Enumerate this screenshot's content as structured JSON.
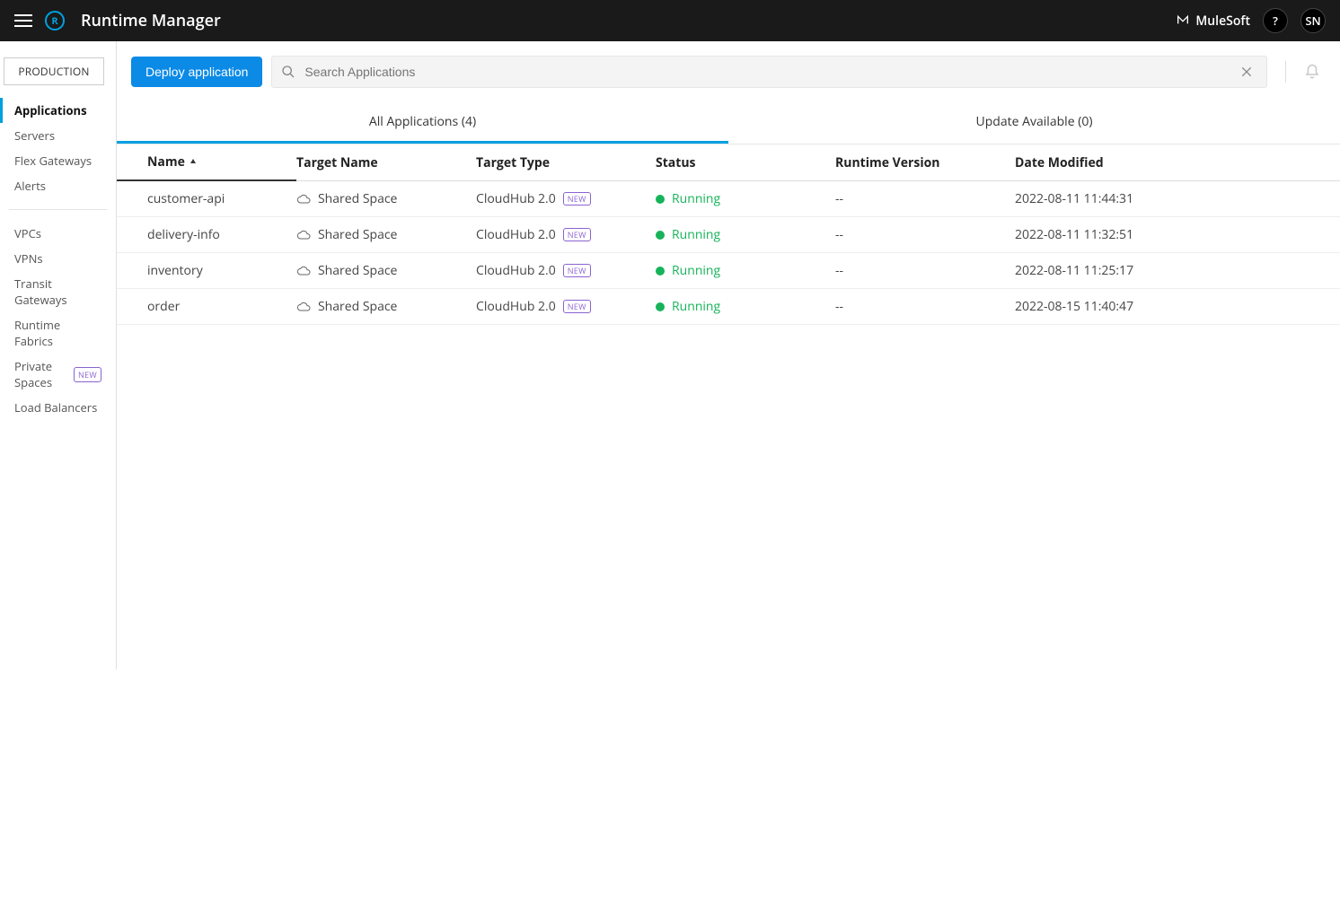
{
  "header": {
    "title": "Runtime Manager",
    "brand": "MuleSoft",
    "help_label": "?",
    "user_initials": "SN"
  },
  "sidebar": {
    "environment": "PRODUCTION",
    "primary": [
      {
        "label": "Applications",
        "active": true
      },
      {
        "label": "Servers",
        "active": false
      },
      {
        "label": "Flex Gateways",
        "active": false
      },
      {
        "label": "Alerts",
        "active": false
      }
    ],
    "secondary": [
      {
        "label": "VPCs",
        "badge": null
      },
      {
        "label": "VPNs",
        "badge": null
      },
      {
        "label": "Transit Gateways",
        "badge": null
      },
      {
        "label": "Runtime Fabrics",
        "badge": null
      },
      {
        "label": "Private Spaces",
        "badge": "NEW"
      },
      {
        "label": "Load Balancers",
        "badge": null
      }
    ]
  },
  "toolbar": {
    "deploy_label": "Deploy application",
    "search_placeholder": "Search Applications"
  },
  "tabs": [
    {
      "label": "All Applications (4)",
      "active": true
    },
    {
      "label": "Update Available (0)",
      "active": false
    }
  ],
  "table": {
    "headers": {
      "name": "Name",
      "target_name": "Target Name",
      "target_type": "Target Type",
      "status": "Status",
      "runtime_version": "Runtime Version",
      "date_modified": "Date Modified"
    },
    "new_badge": "NEW",
    "rows": [
      {
        "name": "customer-api",
        "target_name": "Shared Space",
        "target_type": "CloudHub 2.0",
        "type_new": true,
        "status": "Running",
        "runtime_version": "--",
        "date_modified": "2022-08-11 11:44:31"
      },
      {
        "name": "delivery-info",
        "target_name": "Shared Space",
        "target_type": "CloudHub 2.0",
        "type_new": true,
        "status": "Running",
        "runtime_version": "--",
        "date_modified": "2022-08-11 11:32:51"
      },
      {
        "name": "inventory",
        "target_name": "Shared Space",
        "target_type": "CloudHub 2.0",
        "type_new": true,
        "status": "Running",
        "runtime_version": "--",
        "date_modified": "2022-08-11 11:25:17"
      },
      {
        "name": "order",
        "target_name": "Shared Space",
        "target_type": "CloudHub 2.0",
        "type_new": true,
        "status": "Running",
        "runtime_version": "--",
        "date_modified": "2022-08-15 11:40:47"
      }
    ]
  }
}
